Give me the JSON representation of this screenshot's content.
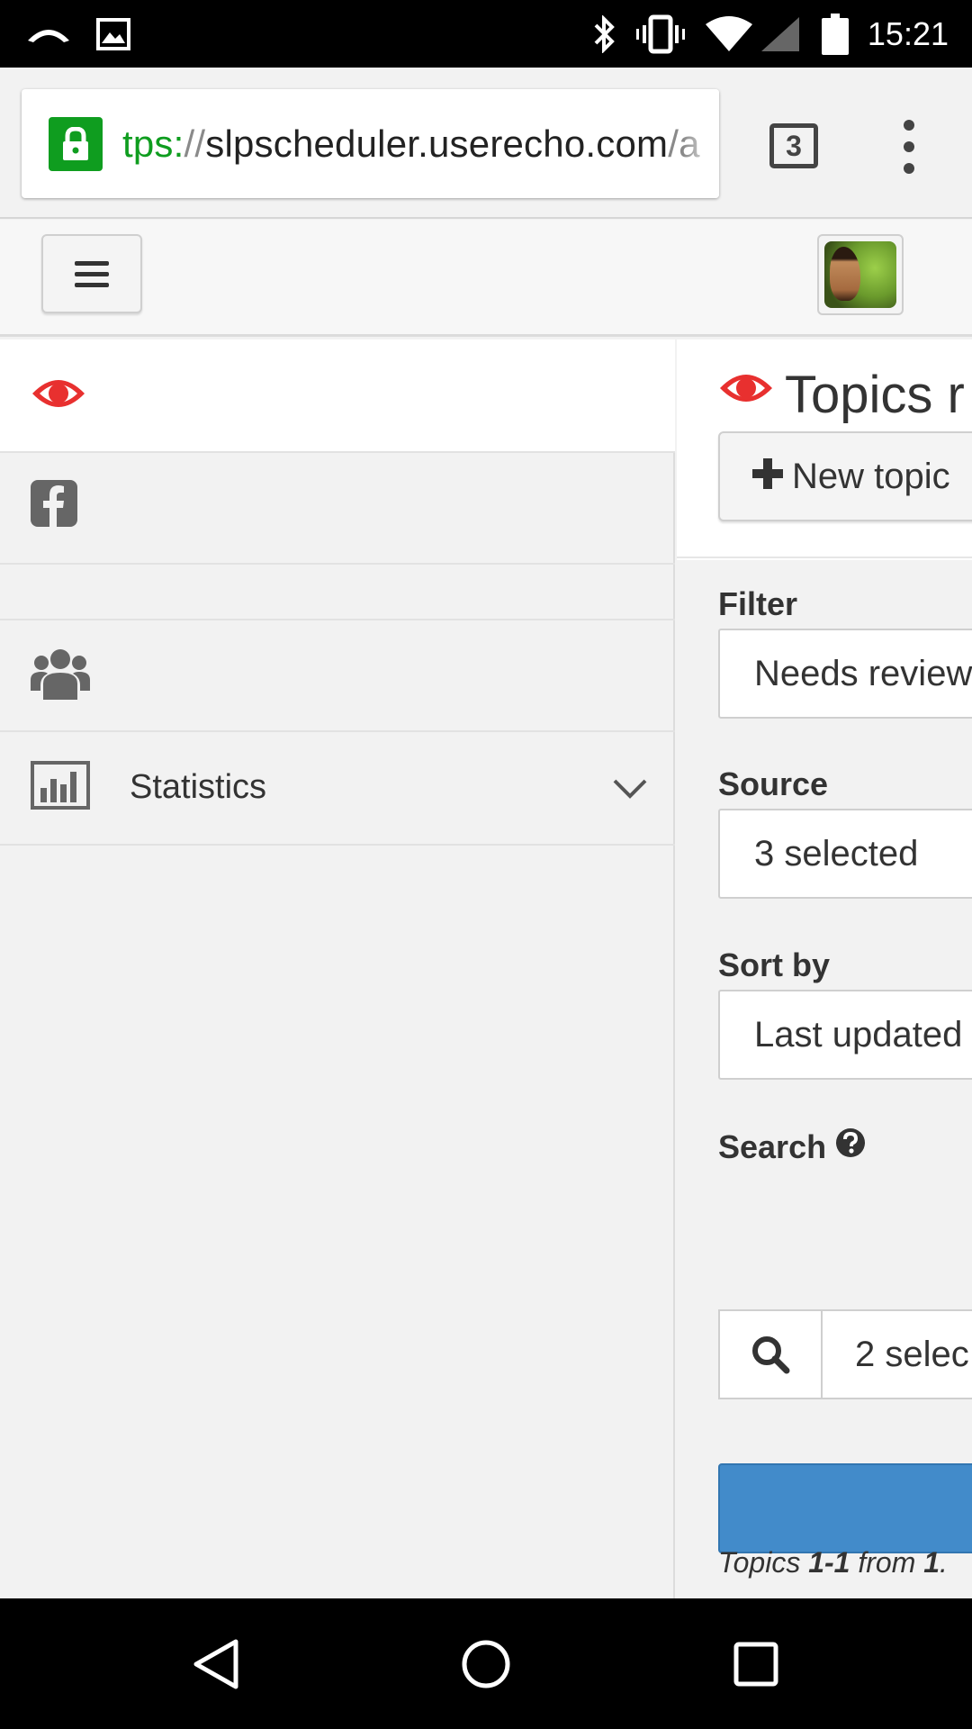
{
  "status_bar": {
    "time": "15:21",
    "icons": [
      "missed-call-icon",
      "image-notification-icon",
      "bluetooth-icon",
      "vibrate-icon",
      "wifi-icon",
      "cell-signal-icon",
      "battery-icon"
    ]
  },
  "browser": {
    "url_scheme": "tps:",
    "url_slashes": "//",
    "url_host": "slpscheduler.userecho.com",
    "url_path": "/a",
    "tab_count": "3",
    "secure_color": "#0f9d1f"
  },
  "sidebar": {
    "items": [
      {
        "icon": "eye-icon",
        "label": "",
        "active": true
      },
      {
        "icon": "facebook-icon",
        "label": ""
      },
      {
        "icon": "",
        "label": ""
      },
      {
        "icon": "users-icon",
        "label": ""
      },
      {
        "icon": "bar-chart-icon",
        "label": "Statistics",
        "expandable": true
      }
    ]
  },
  "main": {
    "title": "Topics r",
    "new_topic_label": "New topic",
    "filter_label": "Filter",
    "filter_value": "Needs review",
    "source_label": "Source",
    "source_value": "3 selected",
    "sort_label": "Sort by",
    "sort_value": "Last updated",
    "search_label": "Search",
    "search_value": "2 selec",
    "apply_label": "",
    "summary_prefix": "Topics ",
    "summary_range": "1-1",
    "summary_mid": " from ",
    "summary_total": "1",
    "summary_suffix": "."
  },
  "colors": {
    "accent_red": "#e8302f",
    "primary_blue": "#428bca",
    "icon_gray": "#666666"
  }
}
